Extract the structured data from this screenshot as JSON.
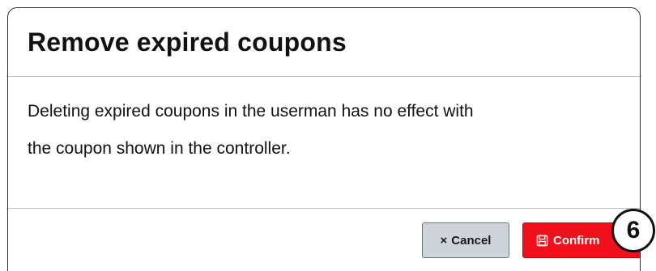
{
  "dialog": {
    "title": "Remove expired coupons",
    "body_line1": "Deleting expired coupons in the userman has no effect with",
    "body_line2": "the coupon shown in the controller."
  },
  "footer": {
    "cancel_icon": "times-icon",
    "cancel_label": "Cancel",
    "confirm_icon": "save-icon",
    "confirm_label": "Confirm"
  },
  "annotation": {
    "step_number": "6"
  },
  "colors": {
    "confirm_bg": "#f0101c",
    "cancel_bg": "#cfd4da",
    "border": "#2b2b2b"
  }
}
